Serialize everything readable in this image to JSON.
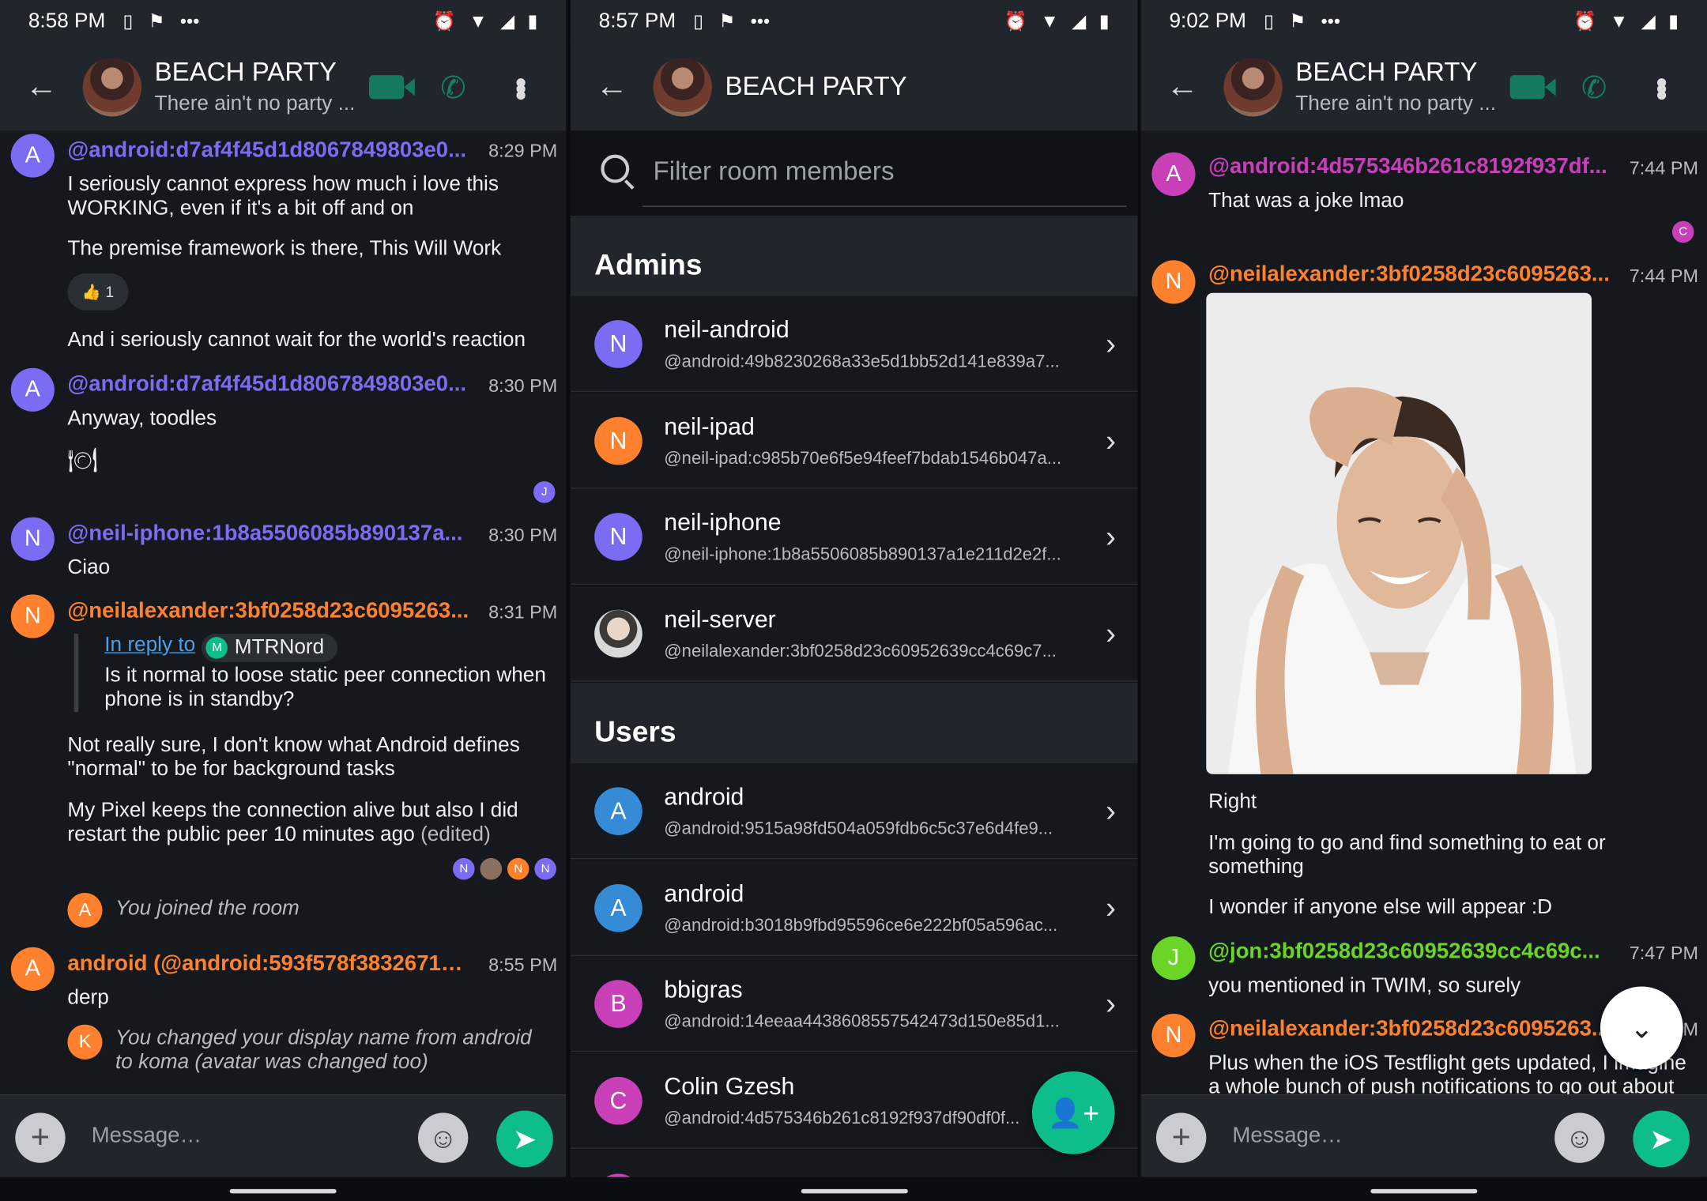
{
  "colors": {
    "accent": "#0dbd8b",
    "purple": "#7a6cf3",
    "orange": "#ff812d",
    "magenta": "#c93fb8",
    "green": "#6ad427",
    "blue": "#368bd6",
    "link": "#4a9fe8"
  },
  "left": {
    "status": {
      "time": "8:58 PM"
    },
    "room": {
      "name": "BEACH PARTY",
      "topic": "There ain't no party ..."
    },
    "messages": {
      "m1": {
        "avatar": "A",
        "sender": "@android:d7af4f45d1d8067849803e0...",
        "time": "8:29 PM",
        "line1": "I seriously cannot express how much i love this WORKING, even if it's a bit off and on",
        "line2": "The premise framework is there, This Will Work",
        "reaction_emoji": "👍",
        "reaction_count": "1",
        "line3": "And i seriously cannot wait for the world's reaction"
      },
      "m2": {
        "avatar": "A",
        "sender": "@android:d7af4f45d1d8067849803e0...",
        "time": "8:30 PM",
        "line1": "Anyway, toodles",
        "line2": "🍽",
        "rr": "J"
      },
      "m3": {
        "avatar": "N",
        "sender": "@neil-iphone:1b8a5506085b890137a...",
        "time": "8:30 PM",
        "line1": "Ciao"
      },
      "m4": {
        "avatar": "N",
        "sender": "@neilalexander:3bf0258d23c6095263...",
        "time": "8:31 PM",
        "reply_link": "In reply to",
        "reply_user_initial": "M",
        "reply_user": "MTRNord",
        "reply_text": "Is it normal to loose static peer connection when phone is in standby?",
        "line1": "Not really sure, I don't know what Android defines \"normal\" to be for background tasks",
        "line2": "My Pixel keeps the connection alive but also I did restart the public peer 10 minutes ago",
        "edited": "(edited)",
        "rr": [
          "N",
          "N",
          "N"
        ]
      },
      "n1": {
        "avatar": "A",
        "text": "You joined the room"
      },
      "m5": {
        "avatar": "A",
        "sender": "android (@android:593f578f38326712...",
        "time": "8:55 PM",
        "line1": "derp"
      },
      "n2": {
        "avatar": "K",
        "text": "You changed your display name from android to koma (avatar was changed too)"
      }
    },
    "composer": {
      "placeholder": "Message…"
    }
  },
  "middle": {
    "status": {
      "time": "8:57 PM"
    },
    "room": {
      "name": "BEACH PARTY"
    },
    "filter_placeholder": "Filter room members",
    "admins_title": "Admins",
    "users_title": "Users",
    "admins": [
      {
        "initial": "N",
        "name": "neil-android",
        "id": "@android:49b8230268a33e5d1bb52d141e839a7..."
      },
      {
        "initial": "N",
        "name": "neil-ipad",
        "id": "@neil-ipad:c985b70e6f5e94feef7bdab1546b047a..."
      },
      {
        "initial": "N",
        "name": "neil-iphone",
        "id": "@neil-iphone:1b8a5506085b890137a1e211d2e2f..."
      },
      {
        "initial": "",
        "name": "neil-server",
        "id": "@neilalexander:3bf0258d23c60952639cc4c69c7..."
      }
    ],
    "users": [
      {
        "initial": "A",
        "name": "android",
        "id": "@android:9515a98fd504a059fdb6c5c37e6d4fe9..."
      },
      {
        "initial": "A",
        "name": "android",
        "id": "@android:b3018b9fbd95596ce6e222bf05a596ac..."
      },
      {
        "initial": "B",
        "name": "bbigras",
        "id": "@android:14eeaa4438608557542473d150e85d1..."
      },
      {
        "initial": "C",
        "name": "Colin Gzesh",
        "id": "@android:4d575346b261c8192f937df90df0f..."
      }
    ]
  },
  "right": {
    "status": {
      "time": "9:02 PM"
    },
    "room": {
      "name": "BEACH PARTY",
      "topic": "There ain't no party ..."
    },
    "messages": {
      "m1": {
        "avatar": "A",
        "sender": "@android:4d575346b261c8192f937df...",
        "time": "7:44 PM",
        "line1": "That was a joke lmao",
        "rr": "C"
      },
      "m2": {
        "avatar": "N",
        "sender": "@neilalexander:3bf0258d23c6095263...",
        "time": "7:44 PM",
        "line1": "Right",
        "line2": "I'm going to go and find something to eat or something",
        "line3": "I wonder if anyone else will appear :D"
      },
      "m3": {
        "avatar": "J",
        "sender": "@jon:3bf0258d23c60952639cc4c69c...",
        "time": "7:47 PM",
        "line1": "you mentioned in TWIM, so surely"
      },
      "m4": {
        "avatar": "N",
        "sender": "@neilalexander:3bf0258d23c6095263...",
        "time": "M",
        "line1": "Plus when the iOS Testflight gets updated, I imagine a whole bunch of push notifications to go out about"
      }
    },
    "composer": {
      "placeholder": "Message…"
    }
  }
}
